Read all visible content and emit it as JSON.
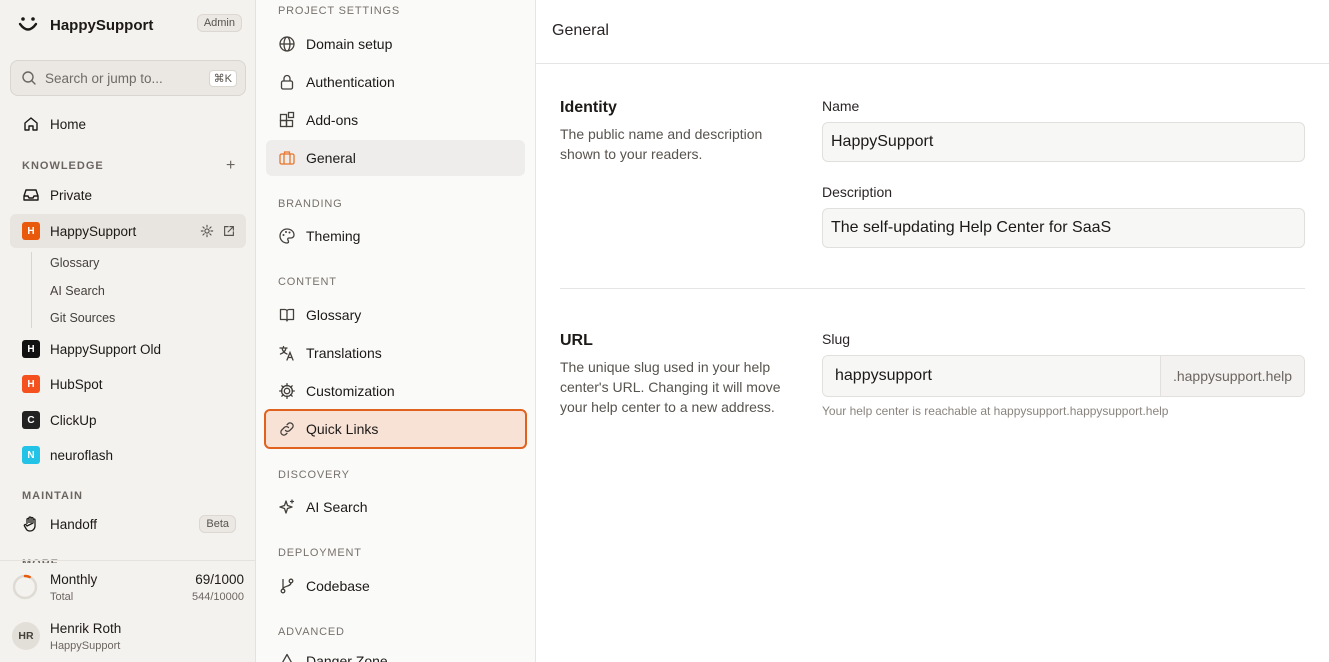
{
  "app": {
    "name": "HappySupport",
    "role_badge": "Admin"
  },
  "search": {
    "placeholder": "Search or jump to...",
    "shortcut": "⌘K"
  },
  "sidebar": {
    "home": "Home",
    "knowledge_label": "KNOWLEDGE",
    "knowledge_items": [
      {
        "label": "Private"
      },
      {
        "label": "HappySupport",
        "initial": "H",
        "color": "#e8590c"
      },
      {
        "label": "HappySupport Old",
        "initial": "H",
        "color": "#111111"
      },
      {
        "label": "HubSpot",
        "initial": "H",
        "color": "#f4511e"
      },
      {
        "label": "ClickUp",
        "initial": "C",
        "color": "#222222"
      },
      {
        "label": "neuroflash",
        "initial": "N",
        "color": "#22c3e6"
      }
    ],
    "sub_items": [
      "Glossary",
      "AI Search",
      "Git Sources"
    ],
    "maintain_label": "MAINTAIN",
    "handoff": "Handoff",
    "beta_badge": "Beta",
    "more_label": "MORE"
  },
  "usage": {
    "period": "Monthly",
    "period_count": "69/1000",
    "total_label": "Total",
    "total_count": "544/10000",
    "progress": 0.069
  },
  "user": {
    "initials": "HR",
    "name": "Henrik Roth",
    "org": "HappySupport"
  },
  "settings_nav": {
    "project_label": "PROJECT SETTINGS",
    "domain": "Domain setup",
    "auth": "Authentication",
    "addons": "Add-ons",
    "general": "General",
    "branding_label": "BRANDING",
    "theming": "Theming",
    "content_label": "CONTENT",
    "glossary": "Glossary",
    "translations": "Translations",
    "customization": "Customization",
    "quicklinks": "Quick Links",
    "discovery_label": "DISCOVERY",
    "aisearch": "AI Search",
    "deployment_label": "DEPLOYMENT",
    "codebase": "Codebase",
    "advanced_label": "ADVANCED",
    "danger": "Danger Zone"
  },
  "main": {
    "title": "General",
    "identity": {
      "title": "Identity",
      "description": "The public name and description shown to your readers.",
      "name_label": "Name",
      "name_value": "HappySupport",
      "desc_label": "Description",
      "desc_value": "The self-updating Help Center for SaaS"
    },
    "url": {
      "title": "URL",
      "description": "The unique slug used in your help center's URL. Changing it will move your help center to a new address.",
      "slug_label": "Slug",
      "slug_value": "happysupport",
      "suffix": ".happysupport.help",
      "hint": "Your help center is reachable at happysupport.happysupport.help"
    }
  }
}
